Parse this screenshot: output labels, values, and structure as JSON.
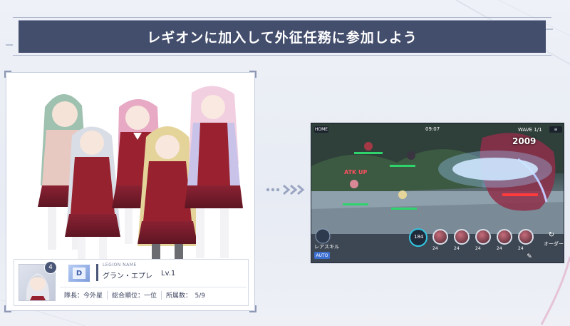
{
  "banner": {
    "title": "レギオンに加入して外征任務に参加しよう"
  },
  "legion_card": {
    "rank": "D",
    "avatar_badge": "4",
    "label": "LEGION NAME",
    "name": "グラン・エプレ",
    "level": "Lv.1",
    "leader": "隊長：今外星",
    "overall_rank": "総合順位：一位",
    "members": "所属数：　5/9"
  },
  "game": {
    "home_label": "HOME",
    "timer": "09:07",
    "wave": "WAVE 1/1",
    "damage": "2009",
    "atk_up": "ATK UP",
    "auto_label": "AUTO",
    "skill_costs": [
      "24",
      "24",
      "24",
      "24",
      "24"
    ],
    "center_count": "184",
    "left_caption": "レアスキル",
    "right_caption": "オーダー"
  },
  "colors": {
    "banner": "#434d6c",
    "card_accent": "#4a5677",
    "rank_badge": "#7e9ddc",
    "arrow": "#9aa5c2",
    "highlight": "#e8f3ff"
  }
}
